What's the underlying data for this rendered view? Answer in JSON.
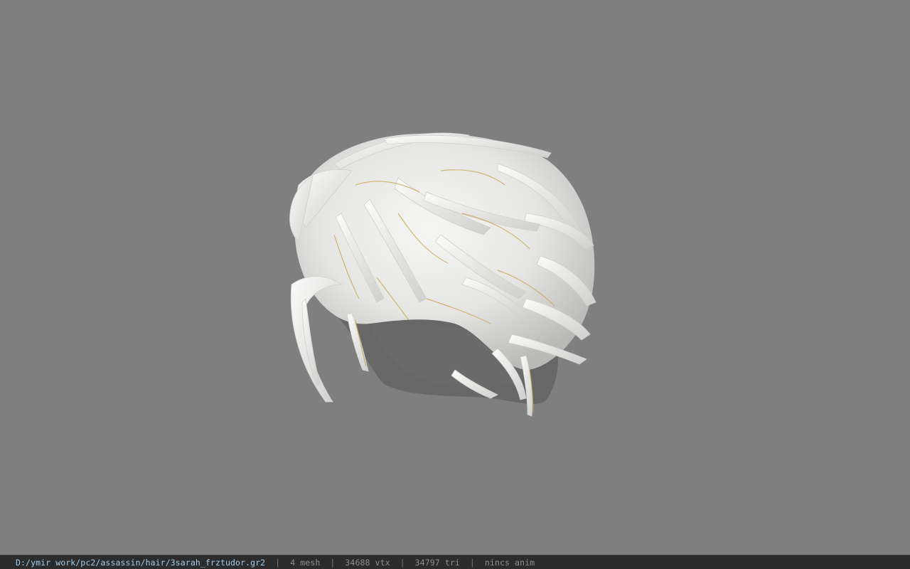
{
  "viewport": {
    "background_color": "#7f7f7f",
    "model_description_icon": "hair-mesh-model"
  },
  "status_bar": {
    "file_path": "D:/ymir work/pc2/assassin/hair/3sarah_frztudor.gr2",
    "separator": "|",
    "mesh_count": "4 mesh",
    "vertex_count": "34688 vtx",
    "triangle_count": "34797 tri",
    "anim_status": "nincs anim",
    "path_color": "#9ecdf0",
    "text_color": "#8f8f8f",
    "background_color": "#2c2c2c"
  }
}
